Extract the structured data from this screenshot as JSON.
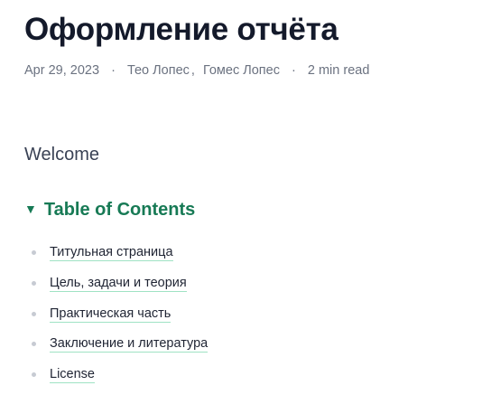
{
  "post": {
    "title": "Оформление отчёта",
    "date": "Apr 29, 2023",
    "authors": [
      "Тео Лопес",
      "Гомес Лопес"
    ],
    "separator": "·",
    "reading_time": "2 min read"
  },
  "content": {
    "intro": "Welcome"
  },
  "toc": {
    "marker": "▼",
    "title": "Table of Contents",
    "items": [
      {
        "label": "Титульная страница"
      },
      {
        "label": "Цель, задачи и теория"
      },
      {
        "label": "Практическая часть"
      },
      {
        "label": "Заключение и литература"
      },
      {
        "label": "License"
      }
    ]
  },
  "colors": {
    "title": "#141a2b",
    "meta": "#6b7280",
    "accent": "#177a55",
    "link_underline": "#9fe2c4"
  }
}
